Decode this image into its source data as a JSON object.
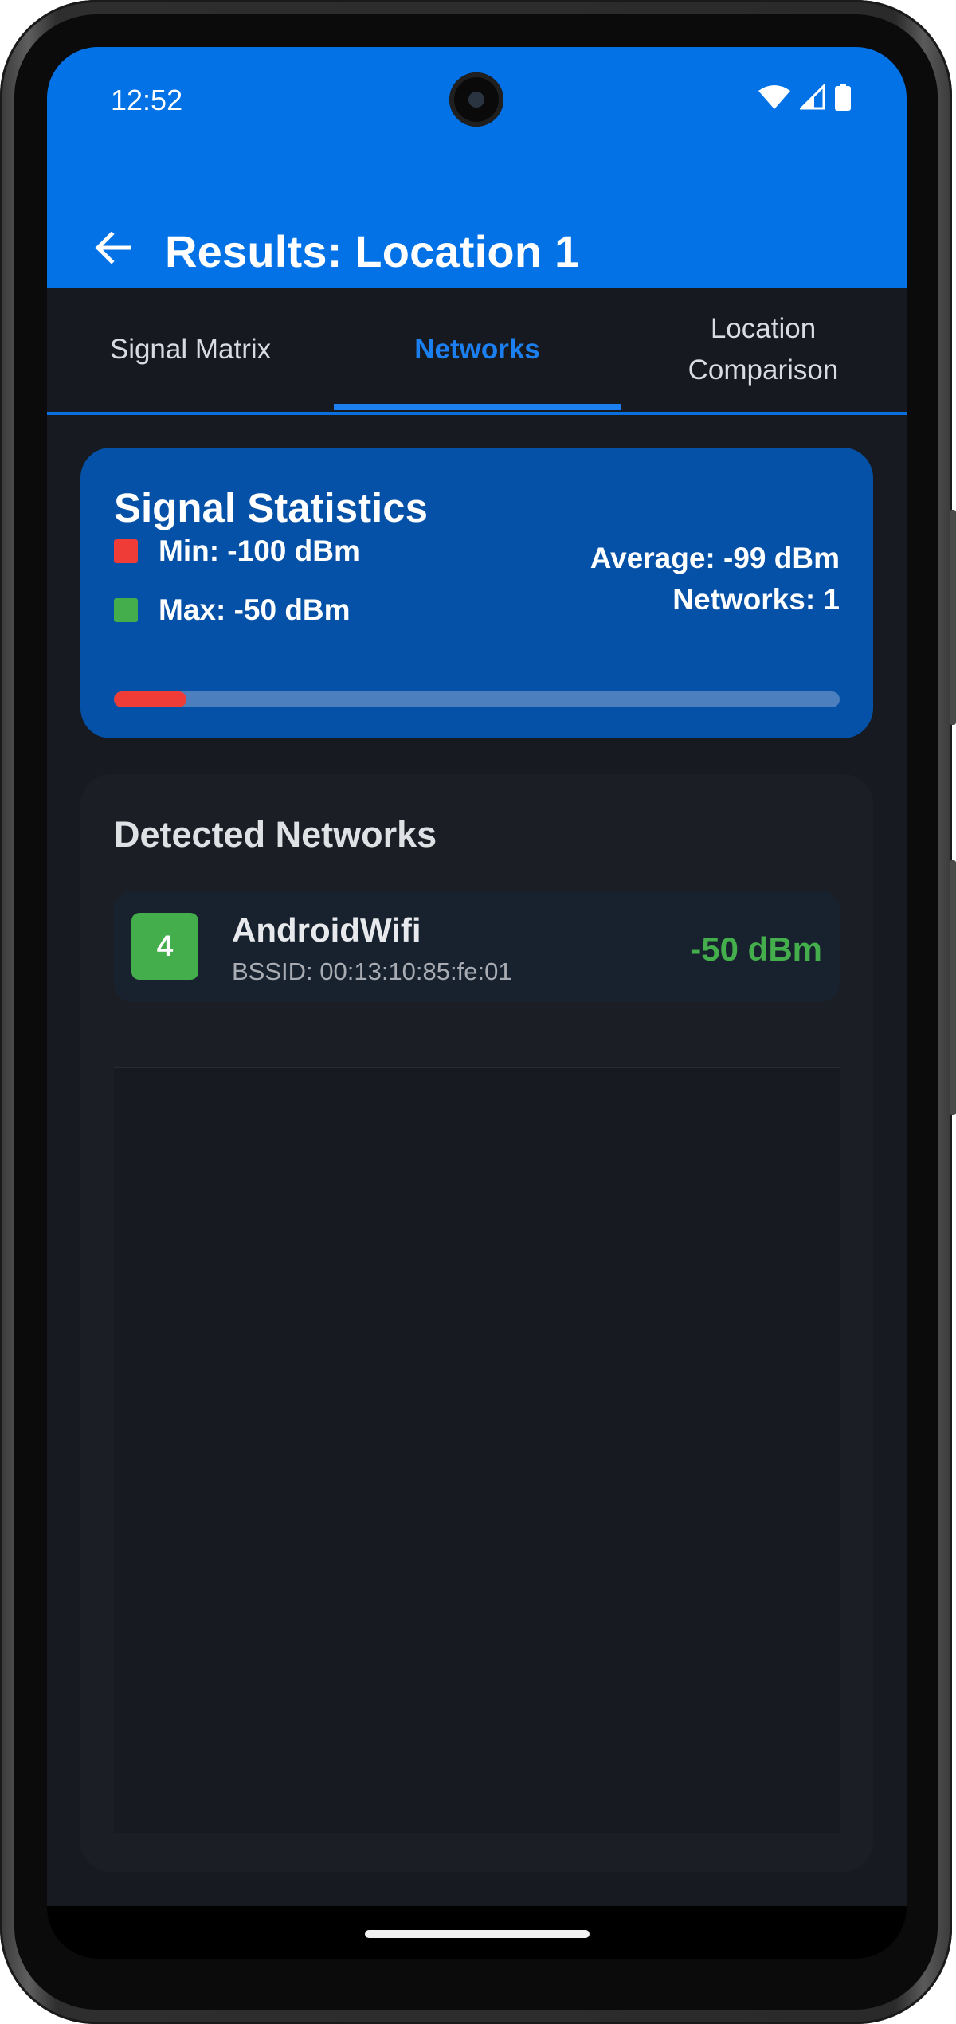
{
  "status_bar": {
    "time": "12:52",
    "icons": [
      "wifi-icon",
      "cellular-signal-icon",
      "battery-icon"
    ]
  },
  "app_bar": {
    "back_icon": "arrow-back-icon",
    "title": "Results: Location 1",
    "background_color": "#0272e6"
  },
  "tabs": [
    {
      "label": "Signal Matrix",
      "active": false
    },
    {
      "label": "Networks",
      "active": true
    },
    {
      "label": "Location Comparison",
      "active": false
    }
  ],
  "signal_statistics": {
    "title": "Signal Statistics",
    "min_label": "Min: -100 dBm",
    "max_label": "Max: -50 dBm",
    "average_label": "Average: -99 dBm",
    "networks_label": "Networks: 1",
    "min_color": "#f03c36",
    "max_color": "#44ad4c",
    "strength_fraction": 0.1
  },
  "detected_networks": {
    "title": "Detected Networks",
    "items": [
      {
        "channel": "4",
        "ssid": "AndroidWifi",
        "bssid": "BSSID: 00:13:10:85:fe:01",
        "rssi": "-50 dBm",
        "color": "#44ad4c"
      }
    ]
  }
}
